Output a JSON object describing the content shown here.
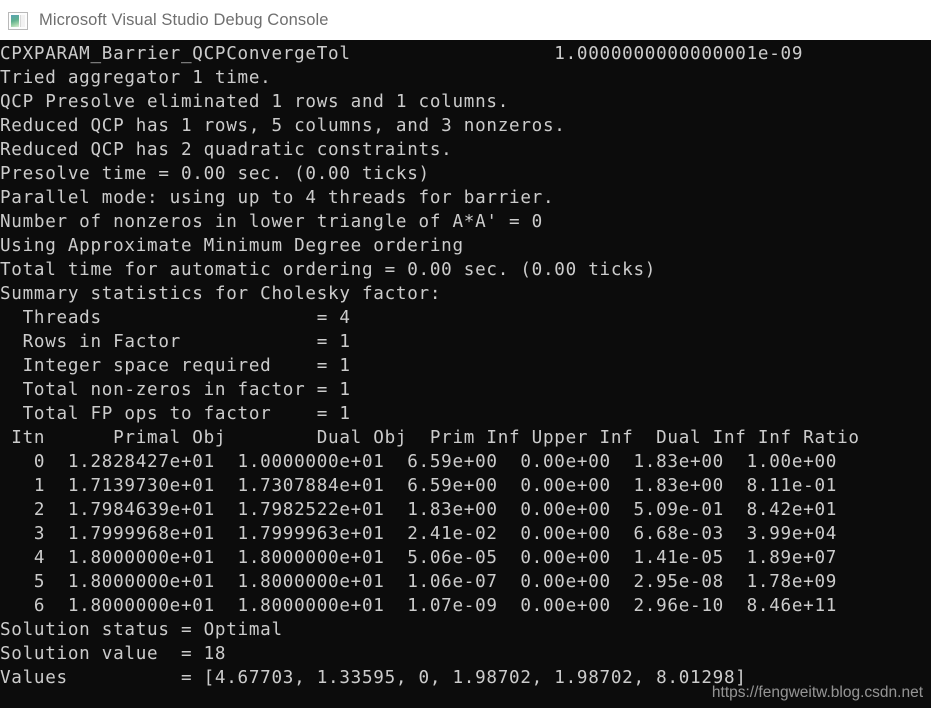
{
  "window": {
    "title": "Microsoft Visual Studio Debug Console",
    "icon": "console-window-icon",
    "titlebar_bg": "#ffffff",
    "title_color": "#6f6f6f",
    "console_bg": "#0c0c0c",
    "console_fg": "#cccccc"
  },
  "console": {
    "lines": [
      "CPXPARAM_Barrier_QCPConvergeTol                  1.0000000000000001e-09",
      "Tried aggregator 1 time.",
      "QCP Presolve eliminated 1 rows and 1 columns.",
      "Reduced QCP has 1 rows, 5 columns, and 3 nonzeros.",
      "Reduced QCP has 2 quadratic constraints.",
      "Presolve time = 0.00 sec. (0.00 ticks)",
      "Parallel mode: using up to 4 threads for barrier.",
      "Number of nonzeros in lower triangle of A*A' = 0",
      "Using Approximate Minimum Degree ordering",
      "Total time for automatic ordering = 0.00 sec. (0.00 ticks)",
      "Summary statistics for Cholesky factor:",
      "  Threads                   = 4",
      "  Rows in Factor            = 1",
      "  Integer space required    = 1",
      "  Total non-zeros in factor = 1",
      "  Total FP ops to factor    = 1",
      " Itn      Primal Obj        Dual Obj  Prim Inf Upper Inf  Dual Inf Inf Ratio",
      "   0  1.2828427e+01  1.0000000e+01  6.59e+00  0.00e+00  1.83e+00  1.00e+00",
      "   1  1.7139730e+01  1.7307884e+01  6.59e+00  0.00e+00  1.83e+00  8.11e-01",
      "   2  1.7984639e+01  1.7982522e+01  1.83e+00  0.00e+00  5.09e-01  8.42e+01",
      "   3  1.7999968e+01  1.7999963e+01  2.41e-02  0.00e+00  6.68e-03  3.99e+04",
      "   4  1.8000000e+01  1.8000000e+01  5.06e-05  0.00e+00  1.41e-05  1.89e+07",
      "   5  1.8000000e+01  1.8000000e+01  1.06e-07  0.00e+00  2.95e-08  1.78e+09",
      "   6  1.8000000e+01  1.8000000e+01  1.07e-09  0.00e+00  2.96e-10  8.46e+11",
      "Solution status = Optimal",
      "Solution value  = 18",
      "Values          = [4.67703, 1.33595, 0, 1.98702, 1.98702, 8.01298]"
    ],
    "solver_params": {
      "CPXPARAM_Barrier_QCPConvergeTol": "1.0000000000000001e-09"
    },
    "presolve": {
      "aggregator_times": "1",
      "eliminated_rows": "1",
      "eliminated_columns": "1",
      "reduced_rows": "1",
      "reduced_columns": "5",
      "reduced_nonzeros": "3",
      "quadratic_constraints": "2",
      "presolve_time_sec": "0.00",
      "presolve_ticks": "0.00"
    },
    "barrier": {
      "parallel_threads": "4",
      "nonzeros_lower_triangle": "0",
      "ordering": "Approximate Minimum Degree ordering",
      "ordering_time_sec": "0.00",
      "ordering_ticks": "0.00"
    },
    "cholesky_stats": {
      "title": "Summary statistics for Cholesky factor:",
      "rows": [
        {
          "label": "Threads",
          "value": "4"
        },
        {
          "label": "Rows in Factor",
          "value": "1"
        },
        {
          "label": "Integer space required",
          "value": "1"
        },
        {
          "label": "Total non-zeros in factor",
          "value": "1"
        },
        {
          "label": "Total FP ops to factor",
          "value": "1"
        }
      ]
    },
    "iteration_table": {
      "headers": [
        "Itn",
        "Primal Obj",
        "Dual Obj",
        "Prim Inf",
        "Upper Inf",
        "Dual Inf",
        "Inf Ratio"
      ],
      "rows": [
        [
          "0",
          "1.2828427e+01",
          "1.0000000e+01",
          "6.59e+00",
          "0.00e+00",
          "1.83e+00",
          "1.00e+00"
        ],
        [
          "1",
          "1.7139730e+01",
          "1.7307884e+01",
          "6.59e+00",
          "0.00e+00",
          "1.83e+00",
          "8.11e-01"
        ],
        [
          "2",
          "1.7984639e+01",
          "1.7982522e+01",
          "1.83e+00",
          "0.00e+00",
          "5.09e-01",
          "8.42e+01"
        ],
        [
          "3",
          "1.7999968e+01",
          "1.7999963e+01",
          "2.41e-02",
          "0.00e+00",
          "6.68e-03",
          "3.99e+04"
        ],
        [
          "4",
          "1.8000000e+01",
          "1.8000000e+01",
          "5.06e-05",
          "0.00e+00",
          "1.41e-05",
          "1.89e+07"
        ],
        [
          "5",
          "1.8000000e+01",
          "1.8000000e+01",
          "1.06e-07",
          "0.00e+00",
          "2.95e-08",
          "1.78e+09"
        ],
        [
          "6",
          "1.8000000e+01",
          "1.8000000e+01",
          "1.07e-09",
          "0.00e+00",
          "2.96e-10",
          "8.46e+11"
        ]
      ]
    },
    "solution": {
      "status_label": "Solution status",
      "status_value": "Optimal",
      "value_label": "Solution value",
      "value_value": "18",
      "values_label": "Values",
      "values_value": "[4.67703, 1.33595, 0, 1.98702, 1.98702, 8.01298]"
    }
  },
  "watermark": {
    "text": "https://fengweitw.blog.csdn.net"
  }
}
